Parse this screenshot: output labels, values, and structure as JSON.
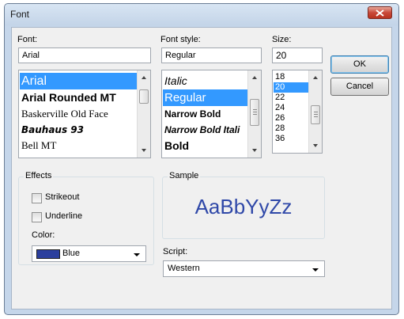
{
  "window": {
    "title": "Font"
  },
  "font": {
    "label": "Font:",
    "value": "Arial",
    "items": [
      "Arial",
      "Arial Rounded MT",
      "Baskerville Old Face",
      "Bauhaus 93",
      "Bell MT"
    ],
    "selected": "Arial"
  },
  "style": {
    "label": "Font style:",
    "value": "Regular",
    "items": [
      "Italic",
      "Regular",
      "Narrow Bold",
      "Narrow Bold Itali",
      "Bold"
    ],
    "selected": "Regular"
  },
  "size": {
    "label": "Size:",
    "value": "20",
    "items": [
      "18",
      "20",
      "22",
      "24",
      "26",
      "28",
      "36"
    ],
    "selected": "20"
  },
  "buttons": {
    "ok": "OK",
    "cancel": "Cancel"
  },
  "effects": {
    "label": "Effects",
    "strikeout": {
      "label": "Strikeout",
      "checked": false
    },
    "underline": {
      "label": "Underline",
      "checked": false
    },
    "color_label": "Color:",
    "color_value": "Blue",
    "color_hex": "#2c3f9d"
  },
  "sample": {
    "label": "Sample",
    "text": "AaBbYyZz",
    "color": "#2f48a8"
  },
  "script": {
    "label": "Script:",
    "value": "Western"
  },
  "colors": {
    "selection": "#3399ff",
    "title_bar": "#c9d9ec",
    "close_button": "#c9493a"
  }
}
